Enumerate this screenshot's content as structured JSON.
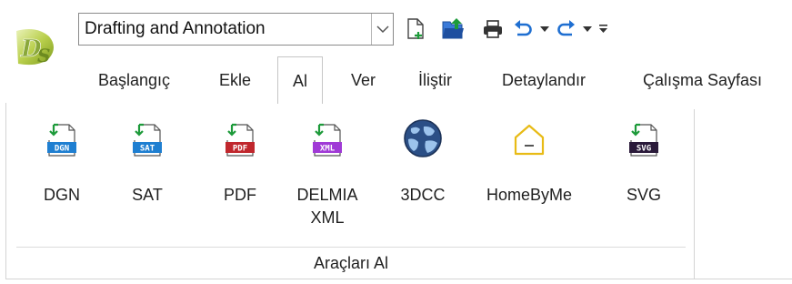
{
  "app": {
    "logo_text": "DS"
  },
  "workspace": {
    "selected": "Drafting and Annotation"
  },
  "quick_access": [
    {
      "icon": "new-file-icon"
    },
    {
      "icon": "open-file-icon"
    },
    {
      "icon": "print-icon"
    },
    {
      "icon": "undo-icon"
    },
    {
      "icon": "undo-dropdown-icon"
    },
    {
      "icon": "redo-icon"
    },
    {
      "icon": "redo-dropdown-icon"
    },
    {
      "icon": "customize-toolbar-icon"
    }
  ],
  "tabs": [
    {
      "label": "Başlangıç",
      "active": false
    },
    {
      "label": "Ekle",
      "active": false
    },
    {
      "label": "Al",
      "active": true
    },
    {
      "label": "Ver",
      "active": false
    },
    {
      "label": "İliştir",
      "active": false
    },
    {
      "label": "Detaylandır",
      "active": false
    },
    {
      "label": "Çalışma Sayfası",
      "active": false
    }
  ],
  "ribbon": {
    "group_title": "Araçları Al",
    "tools": [
      {
        "line1": "DGN",
        "line2": "",
        "badge": "DGN",
        "badge_color": "#1f7fd1"
      },
      {
        "line1": "SAT",
        "line2": "",
        "badge": "SAT",
        "badge_color": "#1f7fd1"
      },
      {
        "line1": "PDF",
        "line2": "",
        "badge": "PDF",
        "badge_color": "#c0272d"
      },
      {
        "line1": "DELMIA",
        "line2": "XML",
        "badge": "XML",
        "badge_color": "#a03ad6"
      },
      {
        "line1": "3DCC",
        "line2": ""
      },
      {
        "line1": "HomeByMe",
        "line2": ""
      },
      {
        "line1": "SVG",
        "line2": "",
        "badge": "SVG",
        "badge_color": "#2a1a3a"
      }
    ]
  }
}
